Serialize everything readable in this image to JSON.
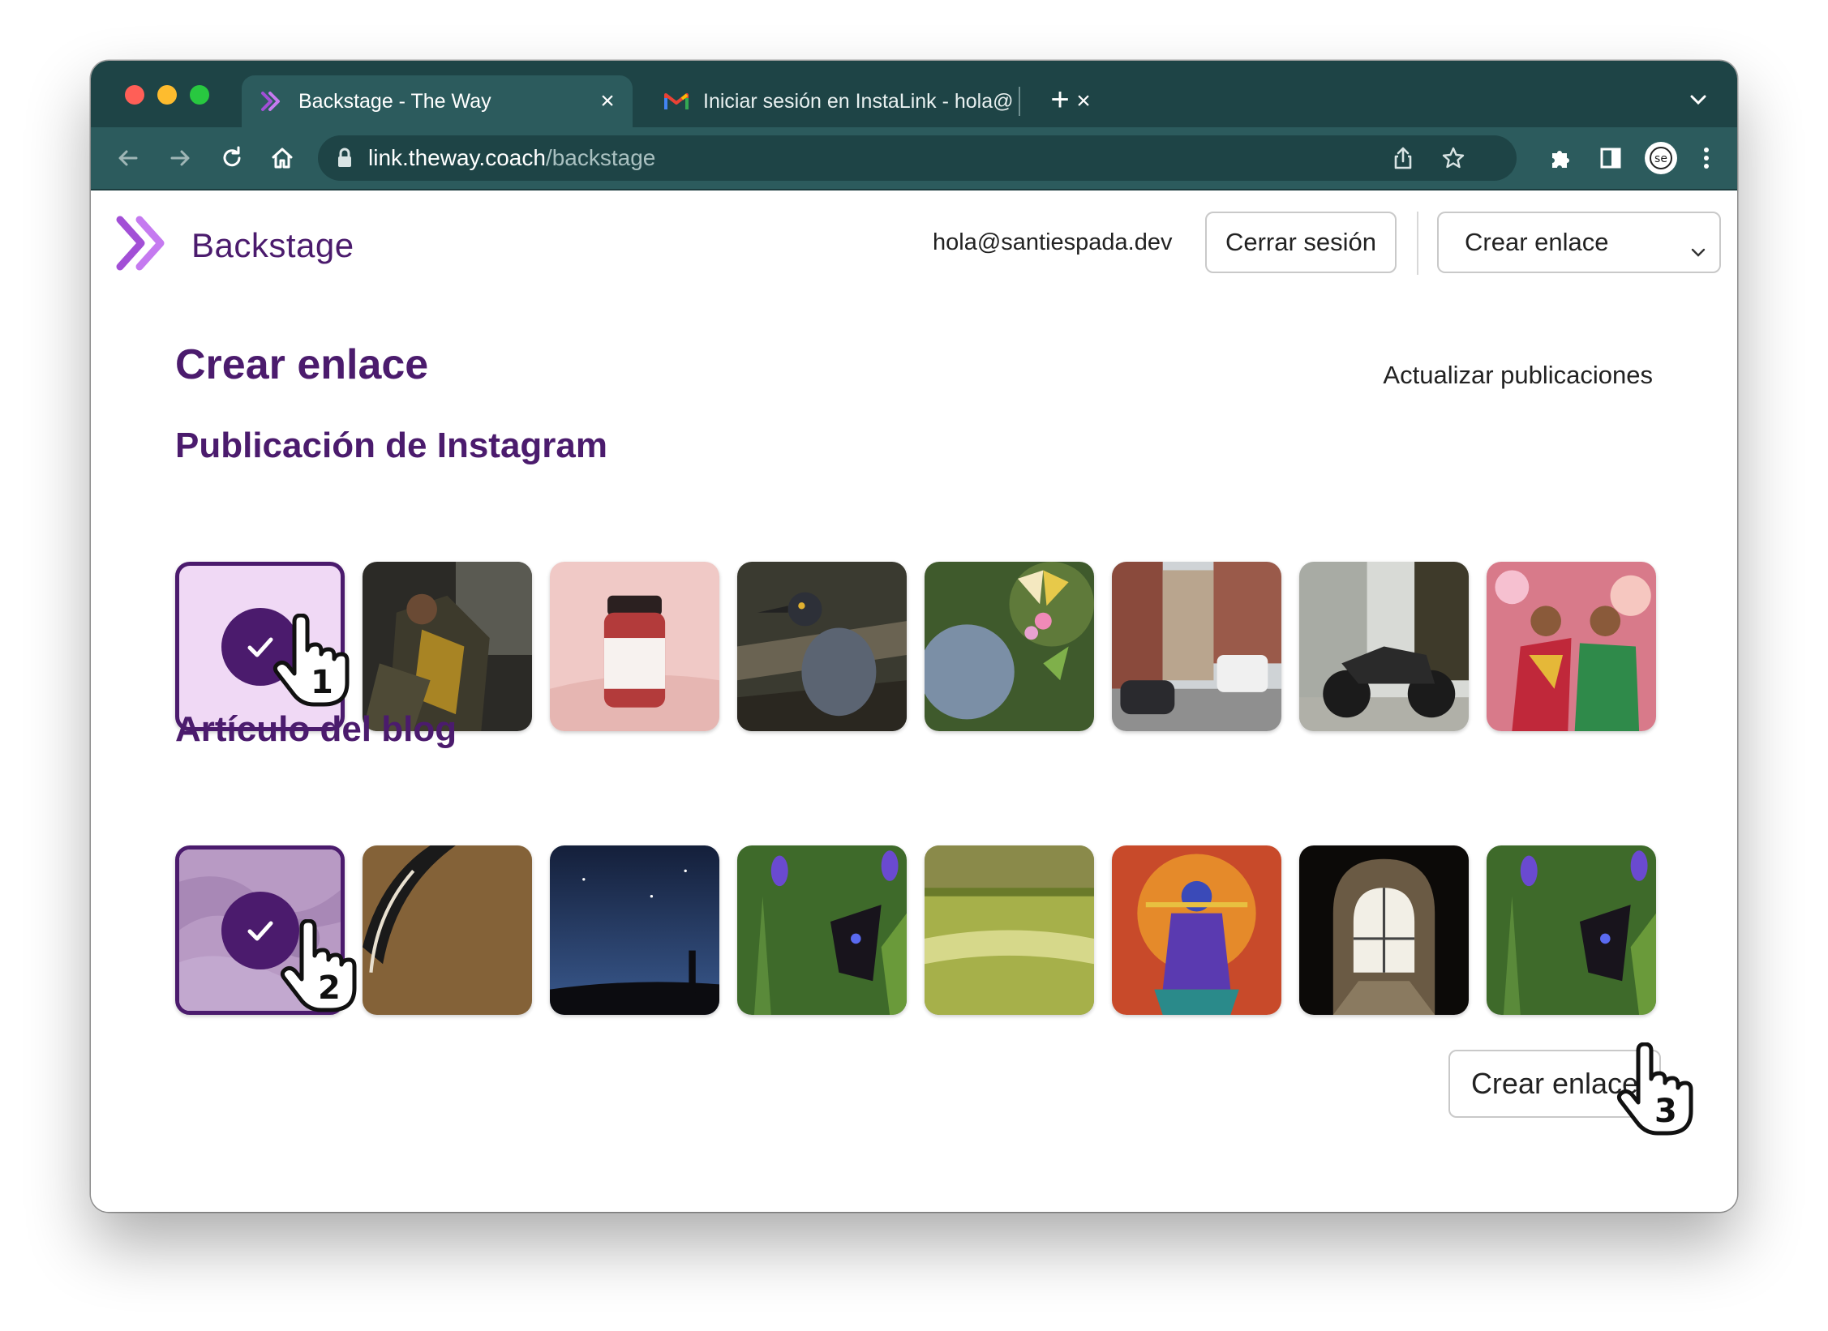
{
  "browser": {
    "tabs": [
      {
        "title": "Backstage - The Way",
        "icon": "backstage-logo-icon",
        "active": true
      },
      {
        "title": "Iniciar sesión en InstaLink - hola@",
        "icon": "gmail-icon",
        "active": false
      }
    ],
    "url_host": "link.theway.coach",
    "url_path": "/backstage",
    "profile_initials": "se"
  },
  "header": {
    "brand": "Backstage",
    "user_email": "hola@santiespada.dev",
    "logout_label": "Cerrar sesión",
    "select_value": "Crear enlace"
  },
  "main": {
    "title": "Crear enlace",
    "refresh_link": "Actualizar publicaciones",
    "instagram_heading": "Publicación de Instagram",
    "blog_heading": "Artículo del blog",
    "create_button": "Crear enlace",
    "instagram_posts": [
      {
        "subject": "selected-placeholder",
        "selected": true
      },
      {
        "subject": "woman-by-window",
        "selected": false
      },
      {
        "subject": "pill-bottle",
        "selected": false
      },
      {
        "subject": "heron-bird",
        "selected": false
      },
      {
        "subject": "butterfly-on-flowers",
        "selected": false
      },
      {
        "subject": "street-with-cars",
        "selected": false
      },
      {
        "subject": "motorcycle",
        "selected": false
      },
      {
        "subject": "dancers",
        "selected": false
      }
    ],
    "blog_posts": [
      {
        "subject": "purple-texture",
        "selected": true
      },
      {
        "subject": "bike-tire",
        "selected": false
      },
      {
        "subject": "night-sky",
        "selected": false
      },
      {
        "subject": "butterfly-purple-flowers",
        "selected": false
      },
      {
        "subject": "sunlit-stream",
        "selected": false
      },
      {
        "subject": "deity-statue",
        "selected": false
      },
      {
        "subject": "church-window",
        "selected": false
      },
      {
        "subject": "butterfly-purple-flowers",
        "selected": false
      }
    ]
  },
  "annotations": {
    "step_1": "1",
    "step_2": "2",
    "step_3": "3"
  },
  "colors": {
    "brand_purple": "#4b1b6d",
    "chrome_dark": "#1e4446",
    "chrome_toolbar": "#2c5b5d"
  }
}
